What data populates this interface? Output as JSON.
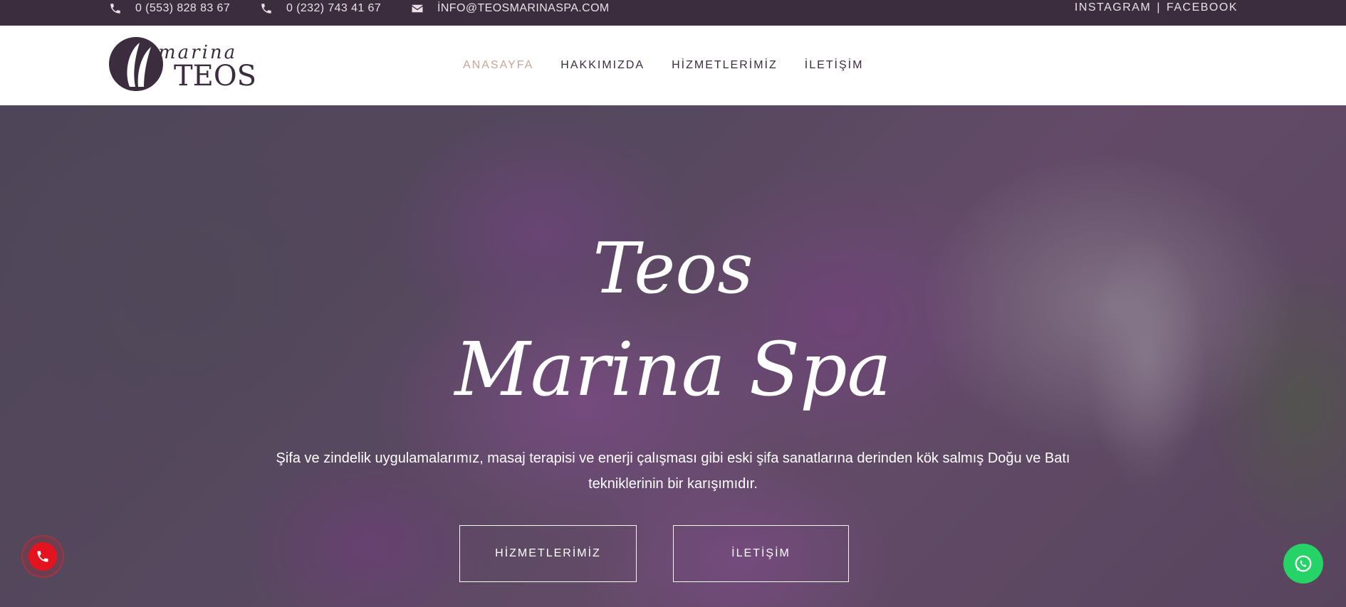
{
  "topbar": {
    "phone1": "0 (553) 828 83 67",
    "phone2": "0 (232) 743 41 67",
    "email": "İNFO@TEOSMARINASPA.COM",
    "social": {
      "instagram": "INSTAGRAM",
      "separator": "|",
      "facebook": "FACEBOOK"
    }
  },
  "logo": {
    "script": "marina",
    "main": "TEOS"
  },
  "nav": {
    "items": [
      {
        "label": "ANASAYFA",
        "active": true
      },
      {
        "label": "HAKKIMIZDA",
        "active": false
      },
      {
        "label": "HİZMETLERİMİZ",
        "active": false
      },
      {
        "label": "İLETİŞİM",
        "active": false
      }
    ]
  },
  "hero": {
    "title_line1": "Teos",
    "title_line2": "Marina Spa",
    "subtitle": "Şifa ve zindelik uygulamalarımız, masaj terapisi ve enerji çalışması gibi eski şifa sanatlarına derinden kök salmış Doğu ve Batı tekniklerinin bir karışımıdır.",
    "buttons": {
      "primary": "HİZMETLERİMİZ",
      "secondary": "İLETİŞİM"
    }
  },
  "floating": {
    "call_icon": "phone-icon",
    "whatsapp_icon": "whatsapp-icon"
  },
  "colors": {
    "topbar_bg": "#3b2c3e",
    "nav_active": "#c8a59a",
    "nav_text": "#3b2c3e",
    "call_red": "#e3141f",
    "whatsapp_green": "#25d366"
  }
}
